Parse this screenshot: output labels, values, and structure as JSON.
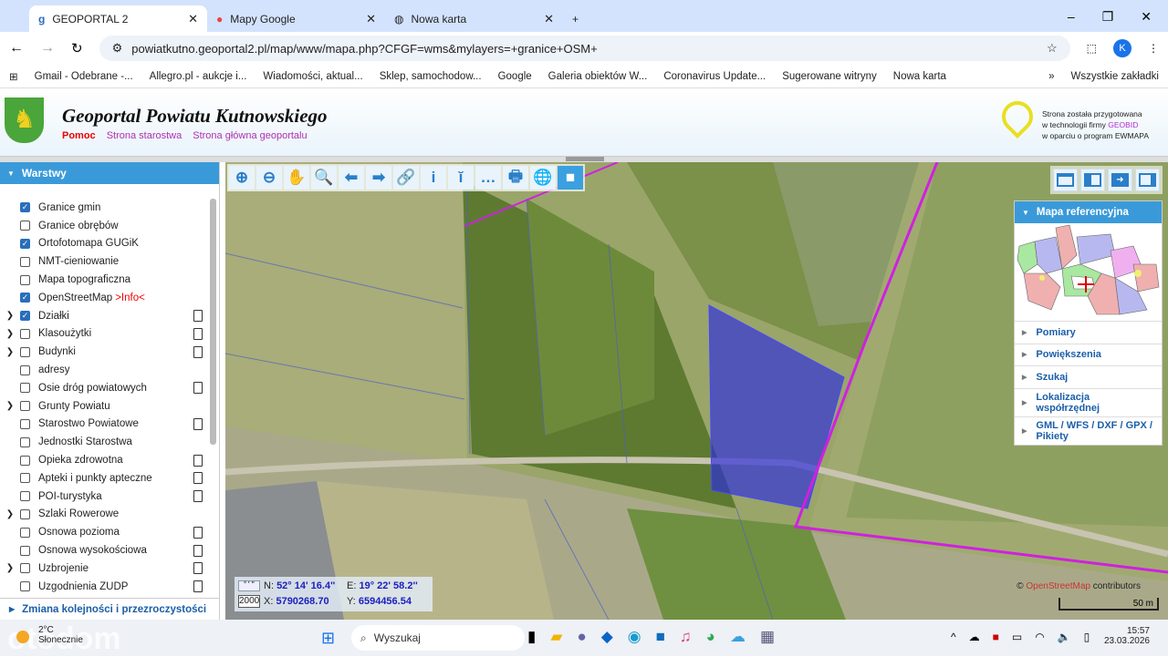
{
  "browser": {
    "tabs": [
      {
        "label": "GEOPORTAL 2",
        "active": true
      },
      {
        "label": "Mapy Google"
      },
      {
        "label": "Nowa karta"
      }
    ],
    "url": "powiatkutno.geoportal2.pl/map/www/mapa.php?CFGF=wms&mylayers=+granice+OSM+",
    "profile": "K",
    "bookmarks": [
      "Gmail - Odebrane -...",
      "Allegro.pl - aukcje i...",
      "Wiadomości, aktual...",
      "Sklep, samochodow...",
      "Google",
      "Galeria obiektów W...",
      "Coronavirus Update...",
      "Sugerowane witryny",
      "Nowa karta"
    ],
    "all_bookmarks": "Wszystkie zakładki"
  },
  "header": {
    "title": "Geoportal Powiatu Kutnowskiego",
    "links": [
      "Pomoc",
      "Strona starostwa",
      "Strona główna geoportalu"
    ],
    "geobid": {
      "line1": "Strona została przygotowana",
      "line2a": "w technologii firmy ",
      "brand": "GEOBID",
      "line3": "w oparciu o program EWMAPA",
      "logo_text": "GEOBID"
    }
  },
  "sidebar": {
    "title": "Warstwy",
    "footer": "Zmiana kolejności i przezroczystości",
    "layers": [
      {
        "label": "Granice gmin",
        "checked": true
      },
      {
        "label": "Granice obrębów",
        "checked": false
      },
      {
        "label": "Ortofotomapa GUGiK",
        "checked": true
      },
      {
        "label": "NMT-cieniowanie",
        "checked": false
      },
      {
        "label": "Mapa topograficzna",
        "checked": false
      },
      {
        "label": "OpenStreetMap",
        "info": ">Info<",
        "checked": true
      },
      {
        "label": "Działki",
        "checked": true,
        "expand": true,
        "doc": true
      },
      {
        "label": "Klasoużytki",
        "checked": false,
        "expand": true,
        "doc": true
      },
      {
        "label": "Budynki",
        "checked": false,
        "expand": true,
        "doc": true
      },
      {
        "label": "adresy",
        "checked": false
      },
      {
        "label": "Osie dróg powiatowych",
        "checked": false,
        "doc": true
      },
      {
        "label": "Grunty Powiatu",
        "checked": false,
        "expand": true
      },
      {
        "label": "Starostwo Powiatowe",
        "checked": false,
        "doc": true
      },
      {
        "label": "Jednostki Starostwa",
        "checked": false
      },
      {
        "label": "Opieka zdrowotna",
        "checked": false,
        "doc": true
      },
      {
        "label": "Apteki i punkty apteczne",
        "checked": false,
        "doc": true
      },
      {
        "label": "POI-turystyka",
        "checked": false,
        "doc": true
      },
      {
        "label": "Szlaki Rowerowe",
        "checked": false,
        "expand": true
      },
      {
        "label": "Osnowa pozioma",
        "checked": false,
        "doc": true
      },
      {
        "label": "Osnowa wysokościowa",
        "checked": false,
        "doc": true
      },
      {
        "label": "Uzbrojenie",
        "checked": false,
        "expand": true,
        "doc": true
      },
      {
        "label": "Uzgodnienia ZUDP",
        "checked": false,
        "doc": true
      }
    ]
  },
  "map": {
    "tools": [
      "zoom-in",
      "zoom-out",
      "pan",
      "zoom-box",
      "back",
      "forward",
      "link",
      "info",
      "info-select",
      "measure",
      "print",
      "globe",
      "camera"
    ],
    "tool_glyphs": [
      "⊕",
      "⊖",
      "✋",
      "🔍",
      "⬅",
      "➡",
      "🔗",
      "i",
      "ĭ",
      "…",
      "🖶",
      "🌐",
      "■"
    ],
    "ref_panel": {
      "title": "Mapa referencyjna",
      "items": [
        "Pomiary",
        "Powiększenia",
        "Szukaj",
        "Lokalizacja współrzędnej",
        "GML / WFS / DXF / GPX / Pikiety"
      ]
    },
    "coords": {
      "format": "° ' ''",
      "system": "2000",
      "N": "52° 14' 16.4''",
      "E": "19° 22' 58.2''",
      "X": "5790268.70",
      "Y": "6594456.54"
    },
    "attribution": "contributors",
    "attribution_prefix": "©",
    "scale": "50 m",
    "colors": {
      "parcel": "#2a2ae0",
      "boundary": "#d020e0"
    }
  },
  "taskbar": {
    "weather": "2°C",
    "weather_sub": "Słonecznie",
    "search": "Wyszukaj",
    "time": "15:57",
    "date": "23.03.2026",
    "watermark": "otodom"
  }
}
